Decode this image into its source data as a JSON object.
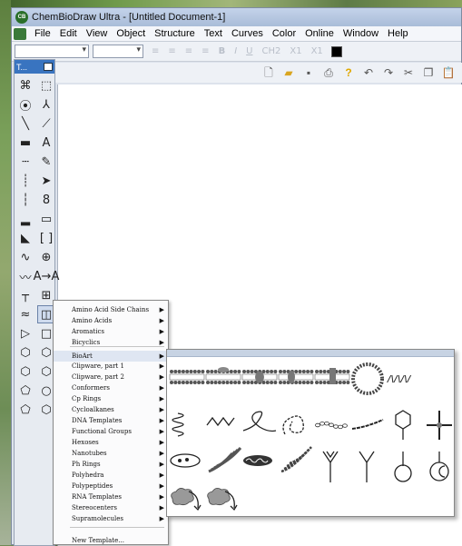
{
  "window": {
    "title": "ChemBioDraw Ultra - [Untitled Document-1]",
    "app_icon_text": "CB"
  },
  "menubar": [
    "File",
    "Edit",
    "View",
    "Object",
    "Structure",
    "Text",
    "Curves",
    "Color",
    "Online",
    "Window",
    "Help"
  ],
  "format_toolbar": {
    "buttons": [
      "B",
      "I",
      "U",
      "CH2",
      "X1",
      "X1"
    ],
    "color_swatch": "#000000"
  },
  "palette": {
    "title": "T...",
    "tools": [
      "lasso-select",
      "marquee-select",
      "mass-fragment",
      "structure-to-name",
      "solid-bond",
      "eraser",
      "bold-bond",
      "text",
      "dashed-bond",
      "pen",
      "hashed-wedge",
      "arrow",
      "hashed-bond",
      "orbital",
      "bold-bond-thick",
      "drawing-element",
      "wedge-bond",
      "bracket",
      "wavy-bond",
      "atom-map",
      "chain",
      "a-arrow-b",
      "query",
      "table",
      "multi-bond",
      "template",
      "triangle",
      "square",
      "hexagon",
      "hexagon-open",
      "hexagon-chair",
      "hexagon-ring",
      "cyclopentane",
      "cyclooctane",
      "cyclopentadiene",
      "cyclooctene"
    ]
  },
  "templates_menu": {
    "items": [
      "Amino Acid Side Chains",
      "Amino Acids",
      "Aromatics",
      "Bicyclics",
      "BioArt",
      "Clipware, part 1",
      "Clipware, part 2",
      "Conformers",
      "Cp Rings",
      "Cycloalkanes",
      "DNA Templates",
      "Functional Groups",
      "Hexoses",
      "Nanotubes",
      "Ph Rings",
      "Polyhedra",
      "Polypeptides",
      "RNA Templates",
      "Stereocenters",
      "Supramolecules"
    ],
    "footer": "New Template..."
  },
  "bioart_submenu": {
    "templates": [
      "lipid-bilayer-1",
      "lipid-bilayer-2",
      "lipid-bilayer-3",
      "lipid-bilayer-4",
      "lipid-bilayer-5",
      "liposome",
      "dna-strand",
      "helix-coil",
      "zigzag-chain",
      "loop-chain",
      "knotted-chain",
      "bead-chain",
      "dna-dashed",
      "hexagon-molecule",
      "cross-molecule",
      "cell",
      "golgi",
      "mitochondria",
      "er-membrane",
      "y-receptor-1",
      "y-receptor-2",
      "ball-stick",
      "round-receptor",
      "cloud-arrow-1",
      "cloud-arrow-2"
    ]
  }
}
